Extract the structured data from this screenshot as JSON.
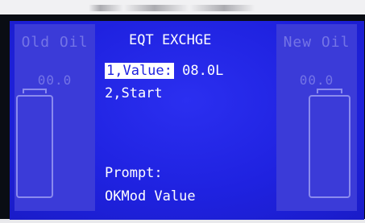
{
  "screen": {
    "title": "EQT EXCHGE",
    "menu": [
      {
        "label": "1,Value:",
        "value": "08.0L"
      },
      {
        "label": "2,Start"
      }
    ],
    "prompt_label": "Prompt:",
    "prompt_message": "OKMod Value"
  },
  "left_panel": {
    "title": "Old Oil",
    "value": "00.0"
  },
  "right_panel": {
    "title": "New Oil",
    "value": "00.0"
  },
  "colors": {
    "background": "#1f22e0",
    "text": "#ffffff",
    "panel": "#3b3bd8"
  }
}
